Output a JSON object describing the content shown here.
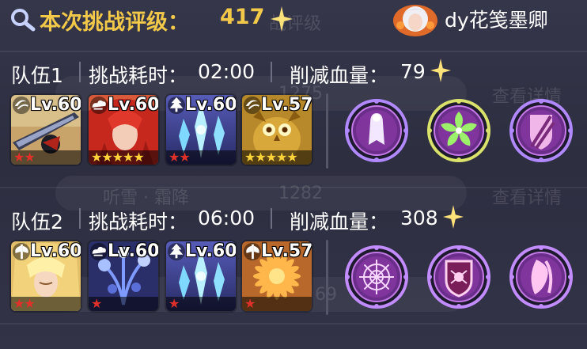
{
  "header": {
    "score_label": "本次挑战评级：",
    "score_value": "417",
    "user_name": "dy花笺墨卿"
  },
  "background_ghost_text": {
    "top_fragment": "战评级",
    "row1_number": "1275",
    "row1_link": "查看详情",
    "row2_name": "听雪 · 霜降",
    "row2_number": "1282",
    "row2_link": "查看详情",
    "row3_number": "69"
  },
  "teams": [
    {
      "name": "队伍1",
      "time_label": "挑战耗时：",
      "time_value": "02:00",
      "damage_label": "削减血量：",
      "damage_value": "79",
      "heroes": [
        {
          "level": "Lv.60",
          "stars": 2,
          "star_color": "red",
          "element": "wind-icon",
          "portrait": "dark-sword"
        },
        {
          "level": "Lv.60",
          "stars": 5,
          "star_color": "gold",
          "element": "cloud-icon",
          "portrait": "red-hair"
        },
        {
          "level": "Lv.60",
          "stars": 2,
          "star_color": "red",
          "element": "tree-icon",
          "portrait": "ice-crystal"
        },
        {
          "level": "Lv.57",
          "stars": 5,
          "star_color": "gold",
          "element": "wind-icon",
          "portrait": "golden-owl"
        }
      ],
      "skills": [
        {
          "icon": "ghost-figure-skill-icon",
          "ring": "#b089ff"
        },
        {
          "icon": "leaf-burst-skill-icon",
          "ring": "#d9e26a"
        },
        {
          "icon": "slash-shield-skill-icon",
          "ring": "#b089ff"
        }
      ]
    },
    {
      "name": "队伍2",
      "time_label": "挑战耗时：",
      "time_value": "06:00",
      "damage_label": "削减血量：",
      "damage_value": "308",
      "heroes": [
        {
          "level": "Lv.60",
          "stars": 2,
          "star_color": "red",
          "element": "axe-icon",
          "portrait": "golden-hair"
        },
        {
          "level": "Lv.60",
          "stars": 1,
          "star_color": "red",
          "element": "cloud-icon",
          "portrait": "blue-flower"
        },
        {
          "level": "Lv.60",
          "stars": 1,
          "star_color": "red",
          "element": "tree-icon",
          "portrait": "ice-crystal"
        },
        {
          "level": "Lv.57",
          "stars": 1,
          "star_color": "red",
          "element": "axe-icon",
          "portrait": "chrysanthemum"
        }
      ],
      "skills": [
        {
          "icon": "spider-web-skill-icon",
          "ring": "#c28cff"
        },
        {
          "icon": "spider-shield-skill-icon",
          "ring": "#c28cff"
        },
        {
          "icon": "tear-slash-skill-icon",
          "ring": "#c28cff"
        }
      ]
    }
  ],
  "colors": {
    "gold_text": "#f3c94a",
    "red_star": "#e0302a",
    "gold_star": "#ffd43a",
    "panel_bg": "#2d2e40"
  }
}
